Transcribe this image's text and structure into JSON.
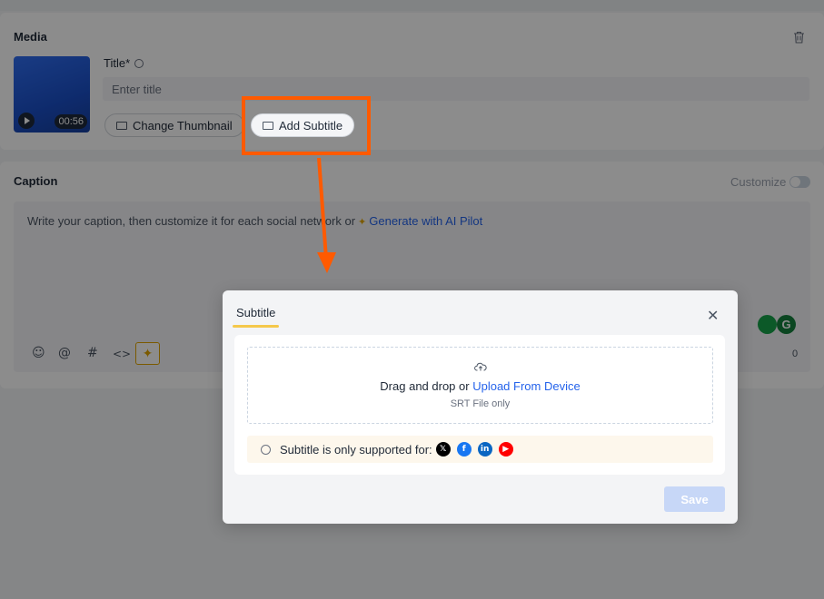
{
  "media": {
    "section_title": "Media",
    "thumbnail_duration": "00:56",
    "title_label": "Title*",
    "title_placeholder": "Enter title",
    "change_thumbnail_label": "Change Thumbnail",
    "add_subtitle_label": "Add Subtitle"
  },
  "caption": {
    "section_title": "Caption",
    "customize_label": "Customize",
    "placeholder_text": "Write your caption, then customize it for each social network or",
    "ai_link": "Generate with AI Pilot",
    "char_count": "0",
    "toolbar_icons": [
      "emoji-icon",
      "mention-icon",
      "hashtag-icon",
      "code-icon",
      "ai-sparkle-icon"
    ]
  },
  "modal": {
    "tab_label": "Subtitle",
    "drop_text": "Drag and drop or",
    "upload_link": "Upload From Device",
    "file_hint": "SRT File only",
    "notice_text": "Subtitle is only supported for:",
    "platforms": [
      "X",
      "Facebook",
      "LinkedIn",
      "YouTube"
    ],
    "save_label": "Save"
  },
  "colors": {
    "highlight": "#ff5a00",
    "link": "#2563eb",
    "tab_underline": "#f5c84b",
    "save_disabled": "#c7d7f7"
  }
}
